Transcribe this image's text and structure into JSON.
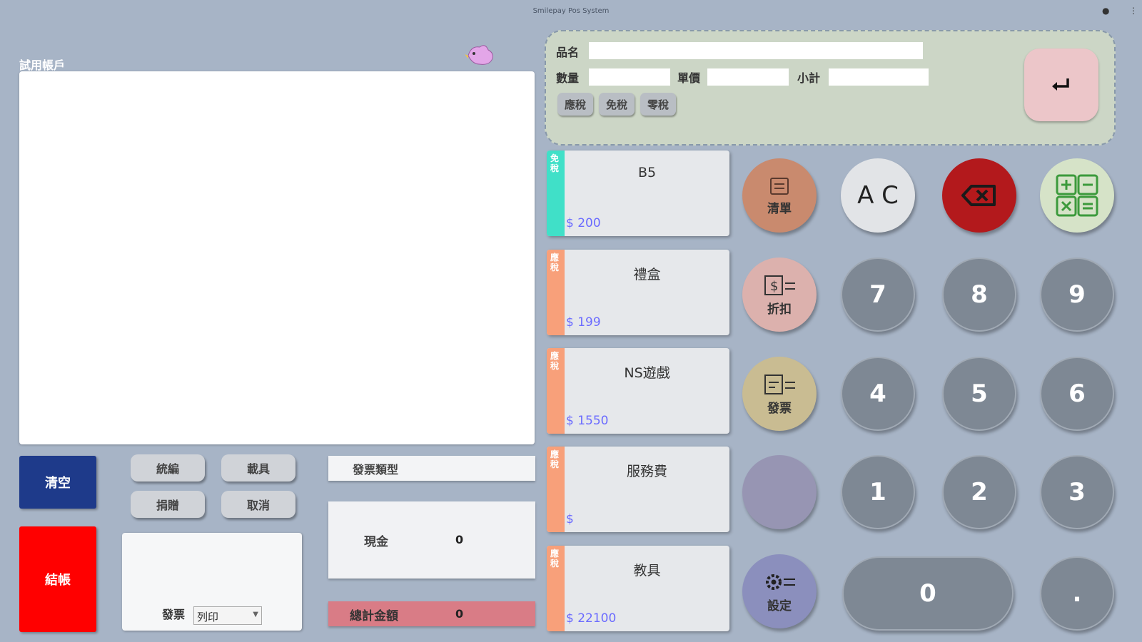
{
  "app": {
    "title": "Smilepay Pos System"
  },
  "left": {
    "account_label": "試用帳戶",
    "buttons": {
      "clear": "清空",
      "checkout": "結帳"
    },
    "small": {
      "tax_id": "統編",
      "staff": "載具",
      "donate": "捐贈",
      "cancel": "取消"
    },
    "invoice": {
      "label": "發票",
      "select_value": "列印"
    },
    "invoice_type": "發票類型",
    "cash": {
      "label": "現金",
      "value": "0"
    },
    "total": {
      "label": "總計金額",
      "value": "0"
    }
  },
  "entry": {
    "name_label": "品名",
    "qty_label": "數量",
    "price_label": "單價",
    "subtotal_label": "小計",
    "tax_buttons": [
      "應稅",
      "免稅",
      "零稅"
    ]
  },
  "products": [
    {
      "tag": "免稅",
      "name": "B5",
      "price": "$ 200",
      "color": "#40e0c8"
    },
    {
      "tag": "應稅",
      "name": "禮盒",
      "price": "$ 199",
      "color": "#f8a07a"
    },
    {
      "tag": "應稅",
      "name": "NS遊戲",
      "price": "$ 1550",
      "color": "#f8a07a"
    },
    {
      "tag": "應稅",
      "name": "服務費",
      "price": "$",
      "color": "#f8a07a"
    },
    {
      "tag": "應稅",
      "name": "教具",
      "price": "$ 22100",
      "color": "#f8a07a"
    }
  ],
  "keypad": {
    "list_label": "清單",
    "discount_label": "折扣",
    "invoice_label": "發票",
    "settings_label": "設定",
    "ac": "A C",
    "digits": {
      "k7": "7",
      "k8": "8",
      "k9": "9",
      "k4": "4",
      "k5": "5",
      "k6": "6",
      "k1": "1",
      "k2": "2",
      "k3": "3",
      "k0": "0",
      "dot": "."
    }
  },
  "colors": {
    "background": "#a7b4c6",
    "clear_btn": "#1e3a8a",
    "checkout_btn": "#ff0000",
    "backspace": "#b3191c",
    "total_box": "#d97c86"
  },
  "icons": {
    "enter": "enter-icon",
    "backspace": "backspace-icon",
    "calculator": "calculator-icon",
    "settings": "gear-icon"
  }
}
